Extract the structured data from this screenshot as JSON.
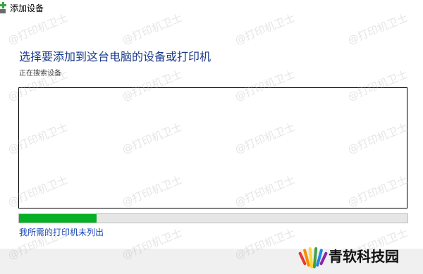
{
  "window": {
    "title": "添加设备",
    "icon": "add-device-icon"
  },
  "main": {
    "heading": "选择要添加到这台电脑的设备或打印机",
    "status": "正在搜索设备",
    "device_list": {
      "items": []
    },
    "progress": {
      "value": 0.2,
      "color": "#06b025"
    },
    "link": "我所需的打印机未列出"
  },
  "watermark": {
    "text": "@打印机卫士"
  },
  "logo": {
    "text": "青软科技园",
    "icon": "logo-mark"
  },
  "colors": {
    "heading": "#1a3a8a",
    "link": "#1a47b8",
    "progress_green": "#06b025",
    "icon_green": "#2fa83a"
  }
}
